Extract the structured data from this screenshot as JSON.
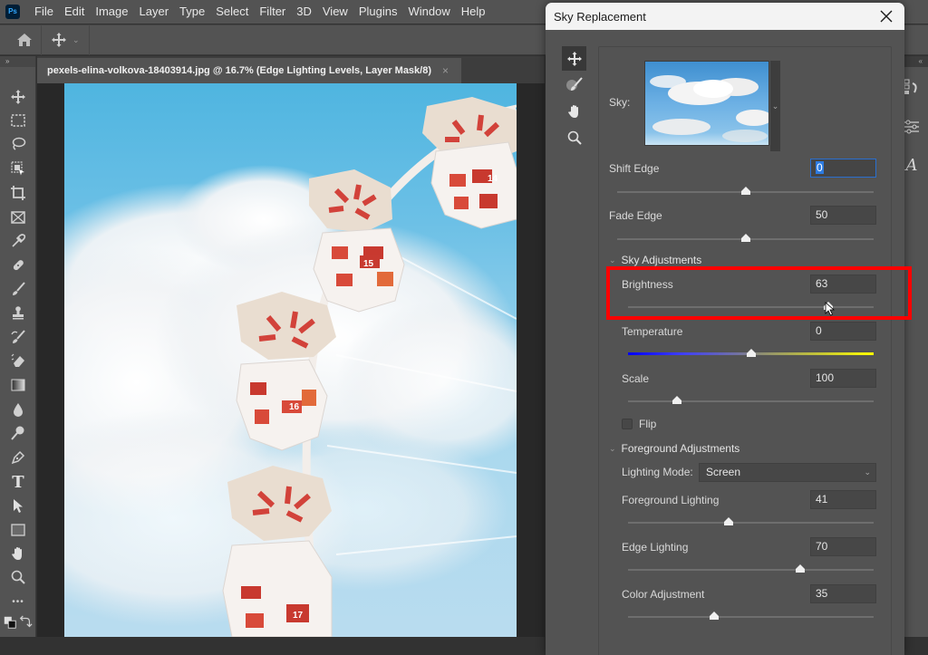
{
  "app": {
    "name": "Adobe Photoshop",
    "logo_text": "Ps"
  },
  "menu": {
    "items": [
      "File",
      "Edit",
      "Image",
      "Layer",
      "Type",
      "Select",
      "Filter",
      "3D",
      "View",
      "Plugins",
      "Window",
      "Help"
    ]
  },
  "options_bar": {
    "home_icon": "home-icon",
    "tool_preset_icon": "move-icon"
  },
  "tools": [
    {
      "name": "move-tool",
      "icon": "move-icon"
    },
    {
      "name": "marquee-tool",
      "icon": "rect-marquee-icon"
    },
    {
      "name": "lasso-tool",
      "icon": "lasso-icon"
    },
    {
      "name": "object-selection-tool",
      "icon": "object-selection-icon"
    },
    {
      "name": "crop-tool",
      "icon": "crop-icon"
    },
    {
      "name": "frame-tool",
      "icon": "frame-icon"
    },
    {
      "name": "eyedropper-tool",
      "icon": "eyedropper-icon"
    },
    {
      "name": "healing-brush-tool",
      "icon": "bandage-icon"
    },
    {
      "name": "brush-tool",
      "icon": "brush-icon"
    },
    {
      "name": "clone-stamp-tool",
      "icon": "stamp-icon"
    },
    {
      "name": "history-brush-tool",
      "icon": "history-brush-icon"
    },
    {
      "name": "eraser-tool",
      "icon": "eraser-icon"
    },
    {
      "name": "gradient-tool",
      "icon": "gradient-icon"
    },
    {
      "name": "blur-tool",
      "icon": "drop-icon"
    },
    {
      "name": "dodge-tool",
      "icon": "dodge-icon"
    },
    {
      "name": "pen-tool",
      "icon": "pen-icon"
    },
    {
      "name": "type-tool",
      "icon": "type-icon",
      "glyph": "T"
    },
    {
      "name": "path-selection-tool",
      "icon": "arrow-icon"
    },
    {
      "name": "rectangle-tool",
      "icon": "rectangle-icon"
    },
    {
      "name": "hand-tool",
      "icon": "hand-icon"
    },
    {
      "name": "zoom-tool",
      "icon": "zoom-icon"
    },
    {
      "name": "edit-toolbar",
      "icon": "more-icon",
      "glyph": "•••"
    }
  ],
  "document": {
    "tab_title": "pexels-elina-volkova-18403914.jpg @ 16.7% (Edge Lighting Levels, Layer Mask/8)",
    "close_glyph": "×",
    "gondola_numbers": [
      "14",
      "15",
      "16",
      "17"
    ]
  },
  "right_dock": {
    "icons": [
      "history-icon",
      "adjustments-icon",
      "glyphs-icon"
    ],
    "glyph_letter": "A"
  },
  "dialog": {
    "title": "Sky Replacement",
    "close_glyph": "✕",
    "tools": [
      "move-sky-icon",
      "sky-brush-icon",
      "hand-icon",
      "zoom-icon"
    ],
    "sky_label": "Sky:",
    "shift_edge": {
      "label": "Shift Edge",
      "value": "0",
      "min": -100,
      "max": 100
    },
    "fade_edge": {
      "label": "Fade Edge",
      "value": "50",
      "min": 0,
      "max": 100
    },
    "sky_adjustments": {
      "header": "Sky Adjustments",
      "brightness": {
        "label": "Brightness",
        "value": "63",
        "min": -100,
        "max": 100
      },
      "temperature": {
        "label": "Temperature",
        "value": "0",
        "min": -100,
        "max": 100
      },
      "scale": {
        "label": "Scale",
        "value": "100",
        "min": 25,
        "max": 400
      },
      "flip": {
        "label": "Flip",
        "checked": false
      }
    },
    "foreground_adjustments": {
      "header": "Foreground Adjustments",
      "lighting_mode": {
        "label": "Lighting Mode:",
        "value": "Screen"
      },
      "foreground_lighting": {
        "label": "Foreground Lighting",
        "value": "41",
        "min": 0,
        "max": 100
      },
      "edge_lighting": {
        "label": "Edge Lighting",
        "value": "70",
        "min": 0,
        "max": 100
      },
      "color_adjustment": {
        "label": "Color Adjustment",
        "value": "35",
        "min": 0,
        "max": 100
      }
    }
  },
  "annotation": {
    "highlight_color": "#ff0000",
    "highlight_target": "Brightness"
  }
}
